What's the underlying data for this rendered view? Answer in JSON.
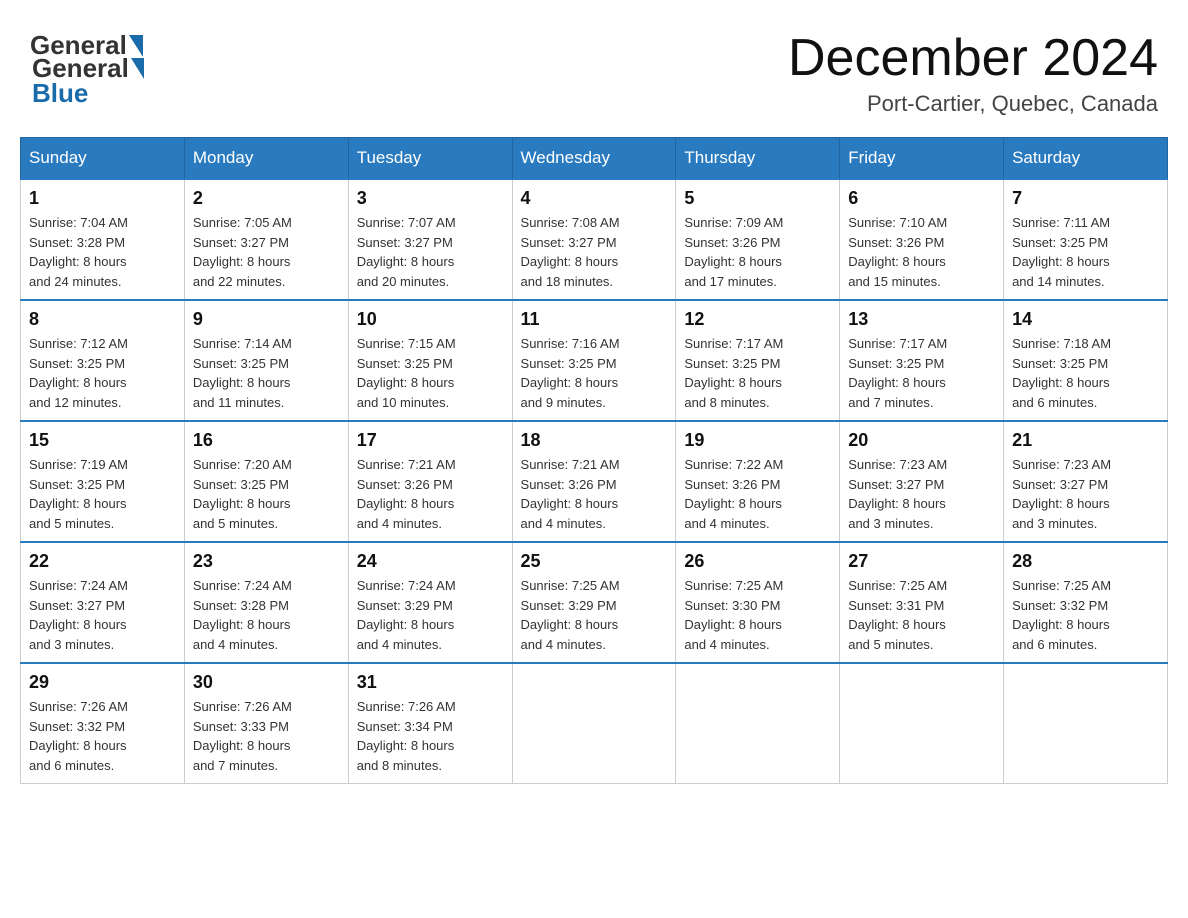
{
  "header": {
    "logo_general": "General",
    "logo_blue": "Blue",
    "month_title": "December 2024",
    "location": "Port-Cartier, Quebec, Canada"
  },
  "days_of_week": [
    "Sunday",
    "Monday",
    "Tuesday",
    "Wednesday",
    "Thursday",
    "Friday",
    "Saturday"
  ],
  "weeks": [
    [
      {
        "day": "1",
        "sunrise": "7:04 AM",
        "sunset": "3:28 PM",
        "daylight": "8 hours and 24 minutes."
      },
      {
        "day": "2",
        "sunrise": "7:05 AM",
        "sunset": "3:27 PM",
        "daylight": "8 hours and 22 minutes."
      },
      {
        "day": "3",
        "sunrise": "7:07 AM",
        "sunset": "3:27 PM",
        "daylight": "8 hours and 20 minutes."
      },
      {
        "day": "4",
        "sunrise": "7:08 AM",
        "sunset": "3:27 PM",
        "daylight": "8 hours and 18 minutes."
      },
      {
        "day": "5",
        "sunrise": "7:09 AM",
        "sunset": "3:26 PM",
        "daylight": "8 hours and 17 minutes."
      },
      {
        "day": "6",
        "sunrise": "7:10 AM",
        "sunset": "3:26 PM",
        "daylight": "8 hours and 15 minutes."
      },
      {
        "day": "7",
        "sunrise": "7:11 AM",
        "sunset": "3:25 PM",
        "daylight": "8 hours and 14 minutes."
      }
    ],
    [
      {
        "day": "8",
        "sunrise": "7:12 AM",
        "sunset": "3:25 PM",
        "daylight": "8 hours and 12 minutes."
      },
      {
        "day": "9",
        "sunrise": "7:14 AM",
        "sunset": "3:25 PM",
        "daylight": "8 hours and 11 minutes."
      },
      {
        "day": "10",
        "sunrise": "7:15 AM",
        "sunset": "3:25 PM",
        "daylight": "8 hours and 10 minutes."
      },
      {
        "day": "11",
        "sunrise": "7:16 AM",
        "sunset": "3:25 PM",
        "daylight": "8 hours and 9 minutes."
      },
      {
        "day": "12",
        "sunrise": "7:17 AM",
        "sunset": "3:25 PM",
        "daylight": "8 hours and 8 minutes."
      },
      {
        "day": "13",
        "sunrise": "7:17 AM",
        "sunset": "3:25 PM",
        "daylight": "8 hours and 7 minutes."
      },
      {
        "day": "14",
        "sunrise": "7:18 AM",
        "sunset": "3:25 PM",
        "daylight": "8 hours and 6 minutes."
      }
    ],
    [
      {
        "day": "15",
        "sunrise": "7:19 AM",
        "sunset": "3:25 PM",
        "daylight": "8 hours and 5 minutes."
      },
      {
        "day": "16",
        "sunrise": "7:20 AM",
        "sunset": "3:25 PM",
        "daylight": "8 hours and 5 minutes."
      },
      {
        "day": "17",
        "sunrise": "7:21 AM",
        "sunset": "3:26 PM",
        "daylight": "8 hours and 4 minutes."
      },
      {
        "day": "18",
        "sunrise": "7:21 AM",
        "sunset": "3:26 PM",
        "daylight": "8 hours and 4 minutes."
      },
      {
        "day": "19",
        "sunrise": "7:22 AM",
        "sunset": "3:26 PM",
        "daylight": "8 hours and 4 minutes."
      },
      {
        "day": "20",
        "sunrise": "7:23 AM",
        "sunset": "3:27 PM",
        "daylight": "8 hours and 3 minutes."
      },
      {
        "day": "21",
        "sunrise": "7:23 AM",
        "sunset": "3:27 PM",
        "daylight": "8 hours and 3 minutes."
      }
    ],
    [
      {
        "day": "22",
        "sunrise": "7:24 AM",
        "sunset": "3:27 PM",
        "daylight": "8 hours and 3 minutes."
      },
      {
        "day": "23",
        "sunrise": "7:24 AM",
        "sunset": "3:28 PM",
        "daylight": "8 hours and 4 minutes."
      },
      {
        "day": "24",
        "sunrise": "7:24 AM",
        "sunset": "3:29 PM",
        "daylight": "8 hours and 4 minutes."
      },
      {
        "day": "25",
        "sunrise": "7:25 AM",
        "sunset": "3:29 PM",
        "daylight": "8 hours and 4 minutes."
      },
      {
        "day": "26",
        "sunrise": "7:25 AM",
        "sunset": "3:30 PM",
        "daylight": "8 hours and 4 minutes."
      },
      {
        "day": "27",
        "sunrise": "7:25 AM",
        "sunset": "3:31 PM",
        "daylight": "8 hours and 5 minutes."
      },
      {
        "day": "28",
        "sunrise": "7:25 AM",
        "sunset": "3:32 PM",
        "daylight": "8 hours and 6 minutes."
      }
    ],
    [
      {
        "day": "29",
        "sunrise": "7:26 AM",
        "sunset": "3:32 PM",
        "daylight": "8 hours and 6 minutes."
      },
      {
        "day": "30",
        "sunrise": "7:26 AM",
        "sunset": "3:33 PM",
        "daylight": "8 hours and 7 minutes."
      },
      {
        "day": "31",
        "sunrise": "7:26 AM",
        "sunset": "3:34 PM",
        "daylight": "8 hours and 8 minutes."
      },
      null,
      null,
      null,
      null
    ]
  ],
  "labels": {
    "sunrise": "Sunrise:",
    "sunset": "Sunset:",
    "daylight": "Daylight:"
  }
}
